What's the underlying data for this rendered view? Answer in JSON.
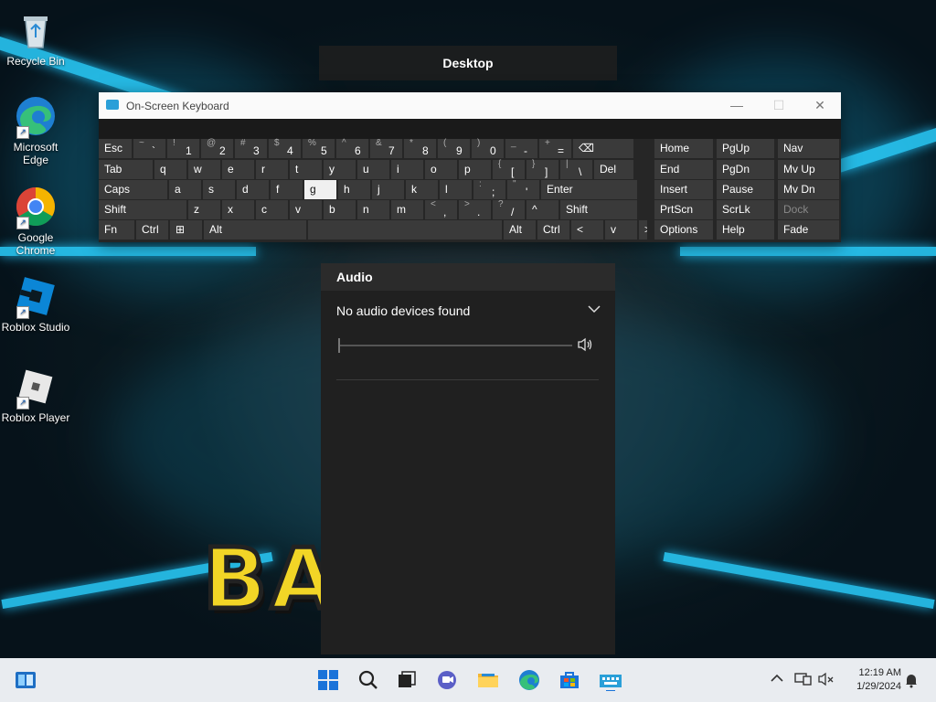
{
  "desktop": {
    "label": "Desktop",
    "icons": [
      {
        "label": "Recycle Bin",
        "icon": "recycle-bin-icon"
      },
      {
        "label": "Microsoft Edge",
        "icon": "edge-icon"
      },
      {
        "label": "Google Chrome",
        "icon": "chrome-icon"
      },
      {
        "label": "Roblox Studio",
        "icon": "roblox-studio-icon"
      },
      {
        "label": "Roblox Player",
        "icon": "roblox-player-icon"
      }
    ],
    "wallpaper_text": "BA    OX"
  },
  "osk": {
    "title": "On-Screen Keyboard",
    "controls": {
      "minimize": "—",
      "maximize": "☐",
      "close": "✕"
    },
    "rows": [
      [
        {
          "lab": "Esc"
        },
        {
          "sub": "~",
          "main": "`"
        },
        {
          "sub": "!",
          "main": "1"
        },
        {
          "sub": "@",
          "main": "2"
        },
        {
          "sub": "#",
          "main": "3"
        },
        {
          "sub": "$",
          "main": "4"
        },
        {
          "sub": "%",
          "main": "5"
        },
        {
          "sub": "^",
          "main": "6"
        },
        {
          "sub": "&",
          "main": "7"
        },
        {
          "sub": "*",
          "main": "8"
        },
        {
          "sub": "(",
          "main": "9"
        },
        {
          "sub": ")",
          "main": "0"
        },
        {
          "sub": "_",
          "main": "-"
        },
        {
          "sub": "+",
          "main": "="
        },
        {
          "lab": "⌫"
        }
      ],
      [
        {
          "lab": "Tab"
        },
        {
          "lab": "q"
        },
        {
          "lab": "w"
        },
        {
          "lab": "e"
        },
        {
          "lab": "r"
        },
        {
          "lab": "t"
        },
        {
          "lab": "y"
        },
        {
          "lab": "u"
        },
        {
          "lab": "i"
        },
        {
          "lab": "o"
        },
        {
          "lab": "p"
        },
        {
          "sub": "{",
          "main": "["
        },
        {
          "sub": "}",
          "main": "]"
        },
        {
          "sub": "|",
          "main": "\\"
        },
        {
          "lab": "Del"
        }
      ],
      [
        {
          "lab": "Caps"
        },
        {
          "lab": "a"
        },
        {
          "lab": "s"
        },
        {
          "lab": "d"
        },
        {
          "lab": "f"
        },
        {
          "lab": "g"
        },
        {
          "lab": "h"
        },
        {
          "lab": "j"
        },
        {
          "lab": "k"
        },
        {
          "lab": "l"
        },
        {
          "sub": ":",
          "main": ";"
        },
        {
          "sub": "\"",
          "main": "'"
        },
        {
          "lab": "Enter"
        }
      ],
      [
        {
          "lab": "Shift"
        },
        {
          "lab": "z"
        },
        {
          "lab": "x"
        },
        {
          "lab": "c"
        },
        {
          "lab": "v"
        },
        {
          "lab": "b"
        },
        {
          "lab": "n"
        },
        {
          "lab": "m"
        },
        {
          "sub": "<",
          "main": ","
        },
        {
          "sub": ">",
          "main": "."
        },
        {
          "sub": "?",
          "main": "/"
        },
        {
          "lab": "^"
        },
        {
          "lab": "Shift"
        }
      ],
      [
        {
          "lab": "Fn"
        },
        {
          "lab": "Ctrl"
        },
        {
          "lab": "⊞"
        },
        {
          "lab": "Alt"
        },
        {
          "lab": ""
        },
        {
          "lab": "Alt"
        },
        {
          "lab": "Ctrl"
        },
        {
          "lab": "<"
        },
        {
          "lab": "v"
        },
        {
          "lab": ">"
        },
        {
          "lab": "☰"
        }
      ]
    ],
    "nav_rows": [
      [
        "Home",
        "PgUp",
        "Nav"
      ],
      [
        "End",
        "PgDn",
        "Mv Up"
      ],
      [
        "Insert",
        "Pause",
        "Mv Dn"
      ],
      [
        "PrtScn",
        "ScrLk",
        "Dock"
      ],
      [
        "Options",
        "Help",
        "Fade"
      ]
    ],
    "highlighted_key": "g",
    "disabled_key": "Dock"
  },
  "audio": {
    "title": "Audio",
    "device": "No audio devices found",
    "volume": 0
  },
  "taskbar": {
    "time": "12:19 AM",
    "date": "1/29/2024"
  }
}
